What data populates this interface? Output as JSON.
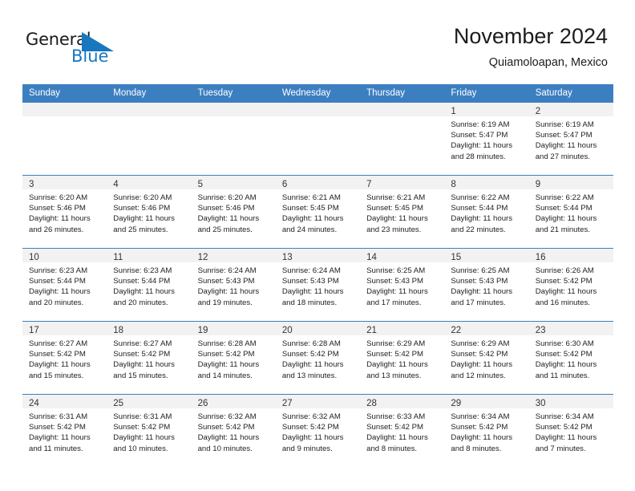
{
  "brand": {
    "name_top": "General",
    "name_bottom": "Blue",
    "accent_color": "#1878be",
    "header_color": "#3c7fc1"
  },
  "header": {
    "title": "November 2024",
    "location": "Quiamoloapan, Mexico"
  },
  "calendar": {
    "weekdays": [
      "Sunday",
      "Monday",
      "Tuesday",
      "Wednesday",
      "Thursday",
      "Friday",
      "Saturday"
    ],
    "weeks": [
      [
        {
          "day": "",
          "lines": []
        },
        {
          "day": "",
          "lines": []
        },
        {
          "day": "",
          "lines": []
        },
        {
          "day": "",
          "lines": []
        },
        {
          "day": "",
          "lines": []
        },
        {
          "day": "1",
          "lines": [
            "Sunrise: 6:19 AM",
            "Sunset: 5:47 PM",
            "Daylight: 11 hours",
            "and 28 minutes."
          ]
        },
        {
          "day": "2",
          "lines": [
            "Sunrise: 6:19 AM",
            "Sunset: 5:47 PM",
            "Daylight: 11 hours",
            "and 27 minutes."
          ]
        }
      ],
      [
        {
          "day": "3",
          "lines": [
            "Sunrise: 6:20 AM",
            "Sunset: 5:46 PM",
            "Daylight: 11 hours",
            "and 26 minutes."
          ]
        },
        {
          "day": "4",
          "lines": [
            "Sunrise: 6:20 AM",
            "Sunset: 5:46 PM",
            "Daylight: 11 hours",
            "and 25 minutes."
          ]
        },
        {
          "day": "5",
          "lines": [
            "Sunrise: 6:20 AM",
            "Sunset: 5:46 PM",
            "Daylight: 11 hours",
            "and 25 minutes."
          ]
        },
        {
          "day": "6",
          "lines": [
            "Sunrise: 6:21 AM",
            "Sunset: 5:45 PM",
            "Daylight: 11 hours",
            "and 24 minutes."
          ]
        },
        {
          "day": "7",
          "lines": [
            "Sunrise: 6:21 AM",
            "Sunset: 5:45 PM",
            "Daylight: 11 hours",
            "and 23 minutes."
          ]
        },
        {
          "day": "8",
          "lines": [
            "Sunrise: 6:22 AM",
            "Sunset: 5:44 PM",
            "Daylight: 11 hours",
            "and 22 minutes."
          ]
        },
        {
          "day": "9",
          "lines": [
            "Sunrise: 6:22 AM",
            "Sunset: 5:44 PM",
            "Daylight: 11 hours",
            "and 21 minutes."
          ]
        }
      ],
      [
        {
          "day": "10",
          "lines": [
            "Sunrise: 6:23 AM",
            "Sunset: 5:44 PM",
            "Daylight: 11 hours",
            "and 20 minutes."
          ]
        },
        {
          "day": "11",
          "lines": [
            "Sunrise: 6:23 AM",
            "Sunset: 5:44 PM",
            "Daylight: 11 hours",
            "and 20 minutes."
          ]
        },
        {
          "day": "12",
          "lines": [
            "Sunrise: 6:24 AM",
            "Sunset: 5:43 PM",
            "Daylight: 11 hours",
            "and 19 minutes."
          ]
        },
        {
          "day": "13",
          "lines": [
            "Sunrise: 6:24 AM",
            "Sunset: 5:43 PM",
            "Daylight: 11 hours",
            "and 18 minutes."
          ]
        },
        {
          "day": "14",
          "lines": [
            "Sunrise: 6:25 AM",
            "Sunset: 5:43 PM",
            "Daylight: 11 hours",
            "and 17 minutes."
          ]
        },
        {
          "day": "15",
          "lines": [
            "Sunrise: 6:25 AM",
            "Sunset: 5:43 PM",
            "Daylight: 11 hours",
            "and 17 minutes."
          ]
        },
        {
          "day": "16",
          "lines": [
            "Sunrise: 6:26 AM",
            "Sunset: 5:42 PM",
            "Daylight: 11 hours",
            "and 16 minutes."
          ]
        }
      ],
      [
        {
          "day": "17",
          "lines": [
            "Sunrise: 6:27 AM",
            "Sunset: 5:42 PM",
            "Daylight: 11 hours",
            "and 15 minutes."
          ]
        },
        {
          "day": "18",
          "lines": [
            "Sunrise: 6:27 AM",
            "Sunset: 5:42 PM",
            "Daylight: 11 hours",
            "and 15 minutes."
          ]
        },
        {
          "day": "19",
          "lines": [
            "Sunrise: 6:28 AM",
            "Sunset: 5:42 PM",
            "Daylight: 11 hours",
            "and 14 minutes."
          ]
        },
        {
          "day": "20",
          "lines": [
            "Sunrise: 6:28 AM",
            "Sunset: 5:42 PM",
            "Daylight: 11 hours",
            "and 13 minutes."
          ]
        },
        {
          "day": "21",
          "lines": [
            "Sunrise: 6:29 AM",
            "Sunset: 5:42 PM",
            "Daylight: 11 hours",
            "and 13 minutes."
          ]
        },
        {
          "day": "22",
          "lines": [
            "Sunrise: 6:29 AM",
            "Sunset: 5:42 PM",
            "Daylight: 11 hours",
            "and 12 minutes."
          ]
        },
        {
          "day": "23",
          "lines": [
            "Sunrise: 6:30 AM",
            "Sunset: 5:42 PM",
            "Daylight: 11 hours",
            "and 11 minutes."
          ]
        }
      ],
      [
        {
          "day": "24",
          "lines": [
            "Sunrise: 6:31 AM",
            "Sunset: 5:42 PM",
            "Daylight: 11 hours",
            "and 11 minutes."
          ]
        },
        {
          "day": "25",
          "lines": [
            "Sunrise: 6:31 AM",
            "Sunset: 5:42 PM",
            "Daylight: 11 hours",
            "and 10 minutes."
          ]
        },
        {
          "day": "26",
          "lines": [
            "Sunrise: 6:32 AM",
            "Sunset: 5:42 PM",
            "Daylight: 11 hours",
            "and 10 minutes."
          ]
        },
        {
          "day": "27",
          "lines": [
            "Sunrise: 6:32 AM",
            "Sunset: 5:42 PM",
            "Daylight: 11 hours",
            "and 9 minutes."
          ]
        },
        {
          "day": "28",
          "lines": [
            "Sunrise: 6:33 AM",
            "Sunset: 5:42 PM",
            "Daylight: 11 hours",
            "and 8 minutes."
          ]
        },
        {
          "day": "29",
          "lines": [
            "Sunrise: 6:34 AM",
            "Sunset: 5:42 PM",
            "Daylight: 11 hours",
            "and 8 minutes."
          ]
        },
        {
          "day": "30",
          "lines": [
            "Sunrise: 6:34 AM",
            "Sunset: 5:42 PM",
            "Daylight: 11 hours",
            "and 7 minutes."
          ]
        }
      ]
    ]
  }
}
